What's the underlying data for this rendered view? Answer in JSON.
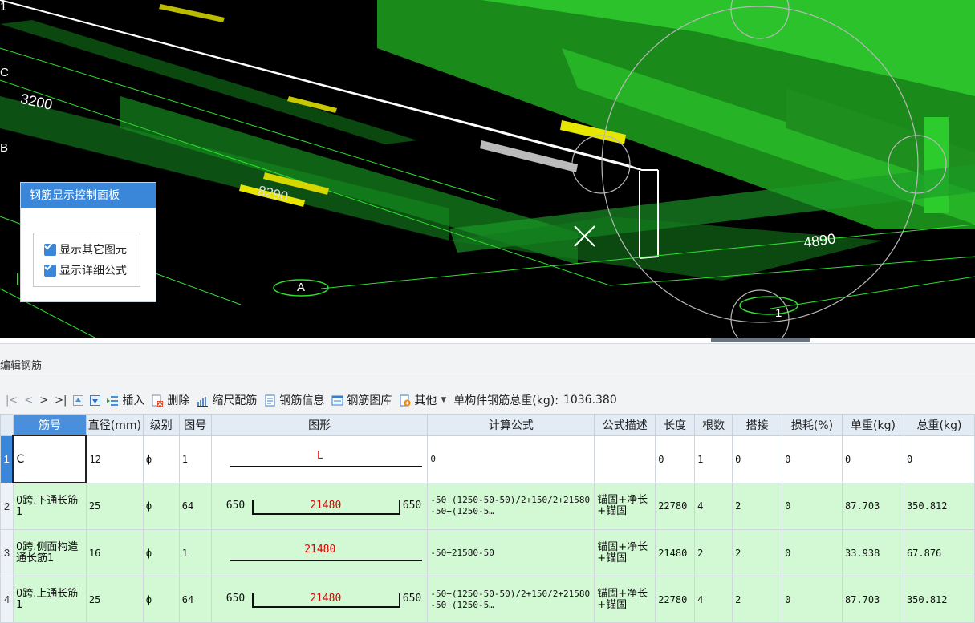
{
  "viewport": {
    "dimensions": [
      "3200",
      "8290",
      "4890"
    ],
    "axis_letters": [
      "C",
      "B",
      "A"
    ],
    "axis_numbers": [
      "1"
    ],
    "corner_label": "1"
  },
  "control_panel": {
    "title": "钢筋显示控制面板",
    "options": [
      {
        "label": "显示其它图元",
        "checked": true
      },
      {
        "label": "显示详细公式",
        "checked": true
      }
    ]
  },
  "editor": {
    "title": "编辑钢筋",
    "toolbar": {
      "nav": [
        "|<",
        "<",
        ">",
        ">|"
      ],
      "insert": "插入",
      "delete": "删除",
      "scale_rebar": "缩尺配筋",
      "rebar_info": "钢筋信息",
      "rebar_library": "钢筋图库",
      "other": "其他",
      "total_weight_label": "单构件钢筋总重(kg):",
      "total_weight_value": "1036.380"
    },
    "columns": [
      "筋号",
      "直径(mm)",
      "级别",
      "图号",
      "图形",
      "计算公式",
      "公式描述",
      "长度",
      "根数",
      "搭接",
      "损耗(%)",
      "单重(kg)",
      "总重(kg)"
    ],
    "rows": [
      {
        "num": "1",
        "name": "C",
        "diameter": "12",
        "grade": "ф",
        "fig": "1",
        "shape": {
          "type": "line",
          "len": "L"
        },
        "formula": "0",
        "desc": "",
        "length": "0",
        "count": "1",
        "lap": "0",
        "loss": "0",
        "unit_weight": "0",
        "total_weight": "0"
      },
      {
        "num": "2",
        "name": "0跨.下通长筋1",
        "diameter": "25",
        "grade": "ф",
        "fig": "64",
        "shape": {
          "type": "hook",
          "left": "650",
          "len": "21480",
          "right": "650"
        },
        "formula": "-50+(1250-50-50)/2+150/2+21580-50+(1250-5…",
        "desc": "锚固+净长+锚固",
        "length": "22780",
        "count": "4",
        "lap": "2",
        "loss": "0",
        "unit_weight": "87.703",
        "total_weight": "350.812"
      },
      {
        "num": "3",
        "name": "0跨.侧面构造通长筋1",
        "diameter": "16",
        "grade": "ф",
        "fig": "1",
        "shape": {
          "type": "line",
          "len": "21480"
        },
        "formula": "-50+21580-50",
        "desc": "锚固+净长+锚固",
        "length": "21480",
        "count": "2",
        "lap": "2",
        "loss": "0",
        "unit_weight": "33.938",
        "total_weight": "67.876"
      },
      {
        "num": "4",
        "name": "0跨.上通长筋1",
        "diameter": "25",
        "grade": "ф",
        "fig": "64",
        "shape": {
          "type": "hook",
          "left": "650",
          "len": "21480",
          "right": "650"
        },
        "formula": "-50+(1250-50-50)/2+150/2+21580-50+(1250-5…",
        "desc": "锚固+净长+锚固",
        "length": "22780",
        "count": "4",
        "lap": "2",
        "loss": "0",
        "unit_weight": "87.703",
        "total_weight": "350.812"
      }
    ]
  },
  "colors": {
    "accent": "#3a86d8",
    "row_green": "#d2f9d4",
    "model_green": "#22b622",
    "dim_red": "#e00000"
  }
}
